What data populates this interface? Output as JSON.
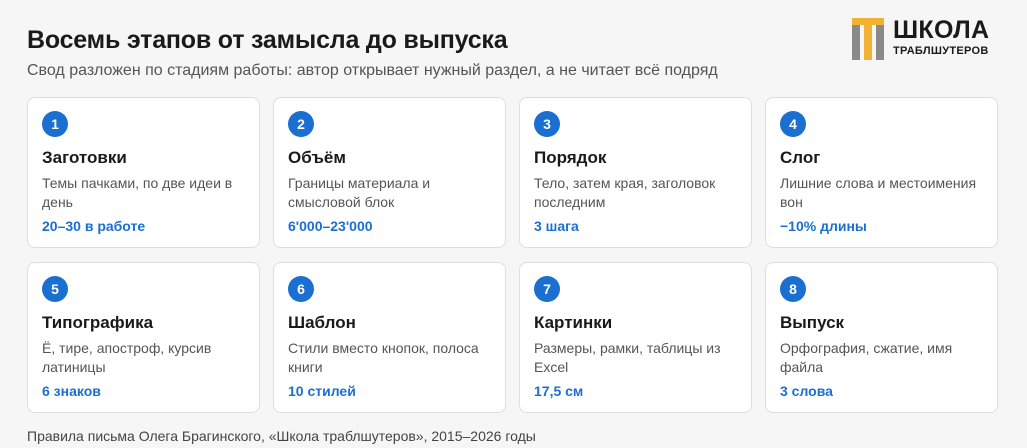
{
  "header": {
    "title": "Восемь этапов от замысла до выпуска",
    "subtitle": "Свод разложен по стадиям работы: автор открывает нужный раздел, а не читает всё подряд"
  },
  "logo": {
    "main": "ШКОЛА",
    "sub": "ТРАБЛШУТЕРОВ",
    "colors": {
      "accent": "#f2b233",
      "gray": "#8a8a8a"
    }
  },
  "stages": [
    {
      "num": "1",
      "title": "Заготовки",
      "desc": "Темы пачками, по две идеи в день",
      "stat": "20–30 в работе"
    },
    {
      "num": "2",
      "title": "Объём",
      "desc": "Границы материала и смысловой блок",
      "stat": "6'000–23'000"
    },
    {
      "num": "3",
      "title": "Порядок",
      "desc": "Тело, затем края, заголовок последним",
      "stat": "3 шага"
    },
    {
      "num": "4",
      "title": "Слог",
      "desc": "Лишние слова и местоимения вон",
      "stat": "−10% длины"
    },
    {
      "num": "5",
      "title": "Типографика",
      "desc": "Ё, тире, апостроф, курсив латиницы",
      "stat": "6 знаков"
    },
    {
      "num": "6",
      "title": "Шаблон",
      "desc": "Стили вместо кнопок, полоса книги",
      "stat": "10 стилей"
    },
    {
      "num": "7",
      "title": "Картинки",
      "desc": "Размеры, рамки, таблицы из Excel",
      "stat": "17,5 см"
    },
    {
      "num": "8",
      "title": "Выпуск",
      "desc": "Орфография, сжатие, имя файла",
      "stat": "3 слова"
    }
  ],
  "footer": "Правила письма Олега Брагинского, «Школа траблшутеров», 2015–2026 годы",
  "colors": {
    "accent": "#1a6fd1"
  }
}
